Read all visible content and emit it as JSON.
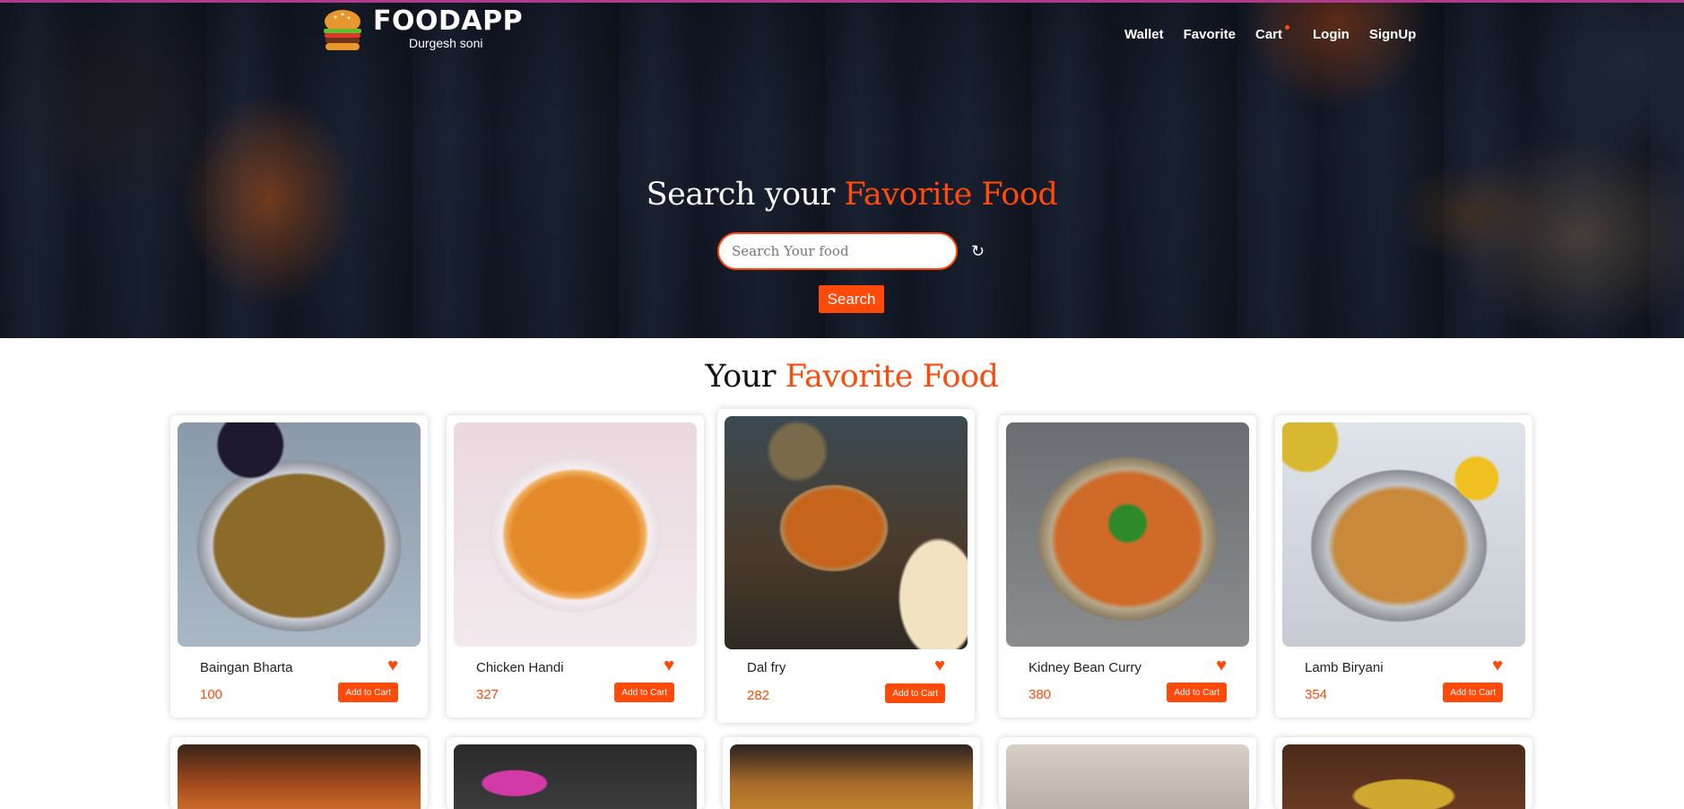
{
  "header": {
    "brand_title": "FOODAPP",
    "brand_subtitle": "Durgesh soni",
    "brand_icon": "burger-icon",
    "nav": [
      "Wallet",
      "Favorite",
      "Cart",
      "Login",
      "SignUp"
    ]
  },
  "hero": {
    "title_prefix": "Search your",
    "title_accent": "Favorite Food",
    "search_placeholder": "Search Your food",
    "search_button": "Search"
  },
  "section": {
    "title_prefix": "Your",
    "title_accent": "Favorite Food"
  },
  "cards": [
    {
      "name": "Baingan Bharta",
      "price": "100",
      "button": "Add to Cart"
    },
    {
      "name": "Chicken Handi",
      "price": "327",
      "button": "Add to Cart"
    },
    {
      "name": "Dal fry",
      "price": "282",
      "button": "Add to Cart"
    },
    {
      "name": "Kidney Bean Curry",
      "price": "380",
      "button": "Add to Cart"
    },
    {
      "name": "Lamb Biryani",
      "price": "354",
      "button": "Add to Cart"
    }
  ],
  "colors": {
    "accent": "#ff4a0a",
    "hero_bg": "#151b29",
    "top_border": "#b23a8a"
  }
}
